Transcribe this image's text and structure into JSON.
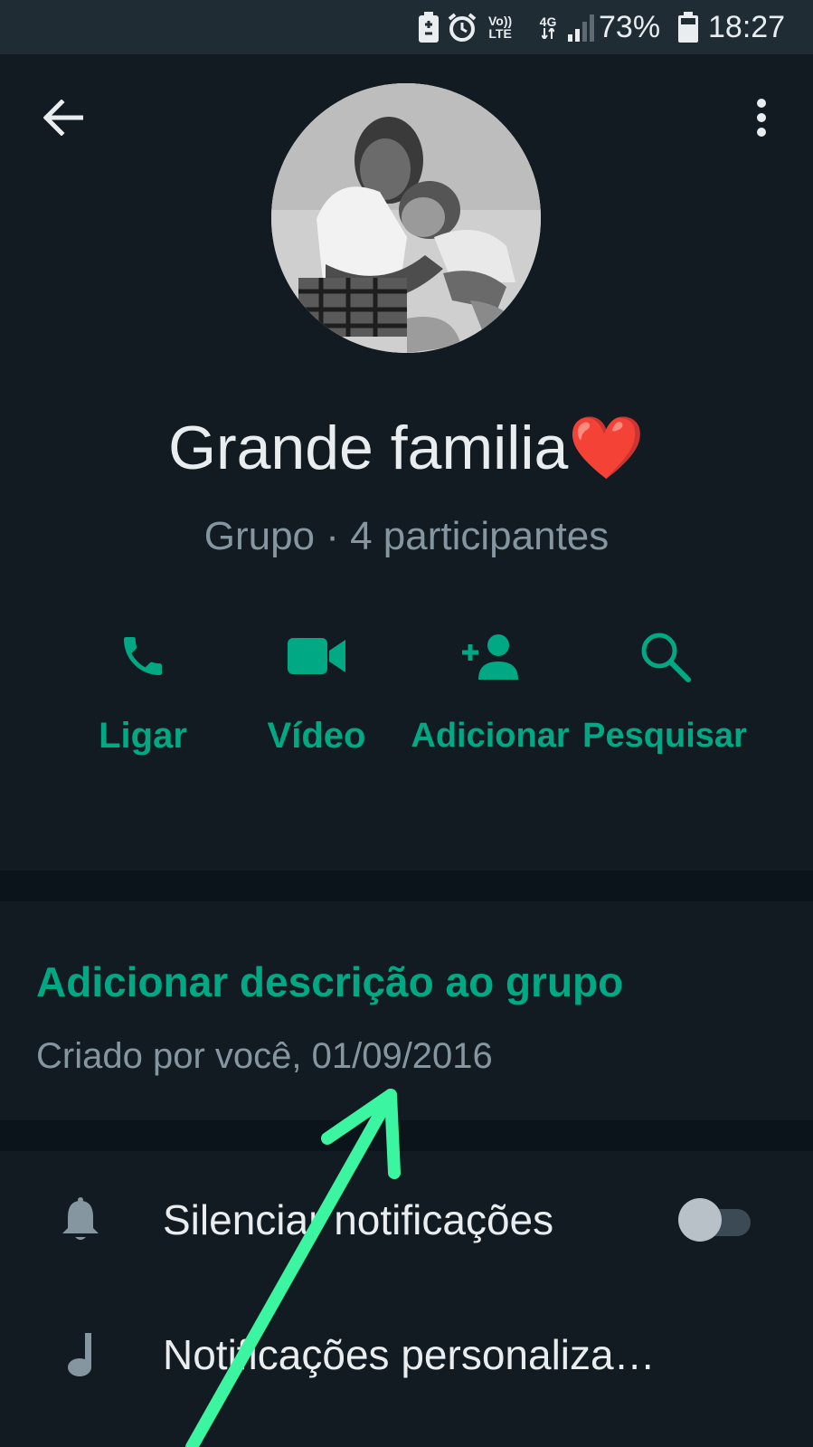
{
  "status_bar": {
    "volte_label": "Vo))\nLTE",
    "network_label": "4G",
    "battery_percent": "73%",
    "time": "18:27"
  },
  "header": {
    "back_icon": "arrow-left-icon",
    "menu_icon": "more-vertical-icon"
  },
  "group": {
    "name": "Grande familia",
    "name_emoji": "❤️",
    "subtitle": "Grupo · 4 participantes"
  },
  "actions": [
    {
      "label": "Ligar",
      "icon": "phone-icon"
    },
    {
      "label": "Vídeo",
      "icon": "video-icon"
    },
    {
      "label": "Adicionar",
      "icon": "add-person-icon"
    },
    {
      "label": "Pesquisar",
      "icon": "search-icon"
    }
  ],
  "description": {
    "link": "Adicionar descrição ao grupo",
    "created": "Criado por você, 01/09/2016"
  },
  "settings": [
    {
      "label": "Silenciar notificações",
      "icon": "bell-icon",
      "toggle_on": false
    },
    {
      "label": "Notificações personaliza…",
      "icon": "music-note-icon"
    }
  ],
  "colors": {
    "accent": "#00a884",
    "background": "#111b21",
    "annotation_arrow": "#3cf5a0"
  }
}
